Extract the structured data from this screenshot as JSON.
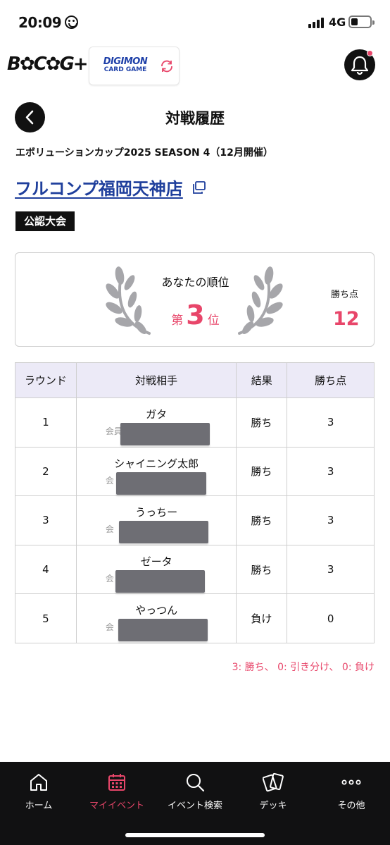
{
  "status_bar": {
    "time": "20:09",
    "network": "4G"
  },
  "header": {
    "brand_logo": "B✿C✿G+",
    "game_logo_line1": "DIGIMON",
    "game_logo_line2": "CARD GAME"
  },
  "page": {
    "title": "対戦履歴",
    "event_name": "エボリューションカップ2025 SEASON 4（12月開催）",
    "store_name": "フルコンプ福岡天神店",
    "tag": "公認大会"
  },
  "rank_card": {
    "label": "あなたの順位",
    "prefix": "第",
    "rank": "3",
    "suffix": "位",
    "points_label": "勝ち点",
    "points": "12"
  },
  "table": {
    "headers": [
      "ラウンド",
      "対戦相手",
      "結果",
      "勝ち点"
    ],
    "rows": [
      {
        "round": "1",
        "opponent": "ガタ",
        "sub": "会員",
        "result": "勝ち",
        "points": "3"
      },
      {
        "round": "2",
        "opponent": "シャイニング太郎",
        "sub": "会",
        "result": "勝ち",
        "points": "3"
      },
      {
        "round": "3",
        "opponent": "うっちー",
        "sub": "会",
        "result": "勝ち",
        "points": "3"
      },
      {
        "round": "4",
        "opponent": "ゼータ",
        "sub": "会",
        "result": "勝ち",
        "points": "3"
      },
      {
        "round": "5",
        "opponent": "やっつん",
        "sub": "会",
        "result": "負け",
        "points": "0"
      }
    ]
  },
  "legend": "3: 勝ち、 0: 引き分け、 0: 負け",
  "bottom_nav": [
    {
      "label": "ホーム",
      "icon": "home-icon"
    },
    {
      "label": "マイイベント",
      "icon": "calendar-icon",
      "active": true
    },
    {
      "label": "イベント検索",
      "icon": "search-icon"
    },
    {
      "label": "デッキ",
      "icon": "cards-icon"
    },
    {
      "label": "その他",
      "icon": "more-icon"
    }
  ],
  "colors": {
    "accent": "#e8466a",
    "link": "#1f3f9c",
    "header_bg": "#eceaf7",
    "nav_bg": "#111112"
  }
}
